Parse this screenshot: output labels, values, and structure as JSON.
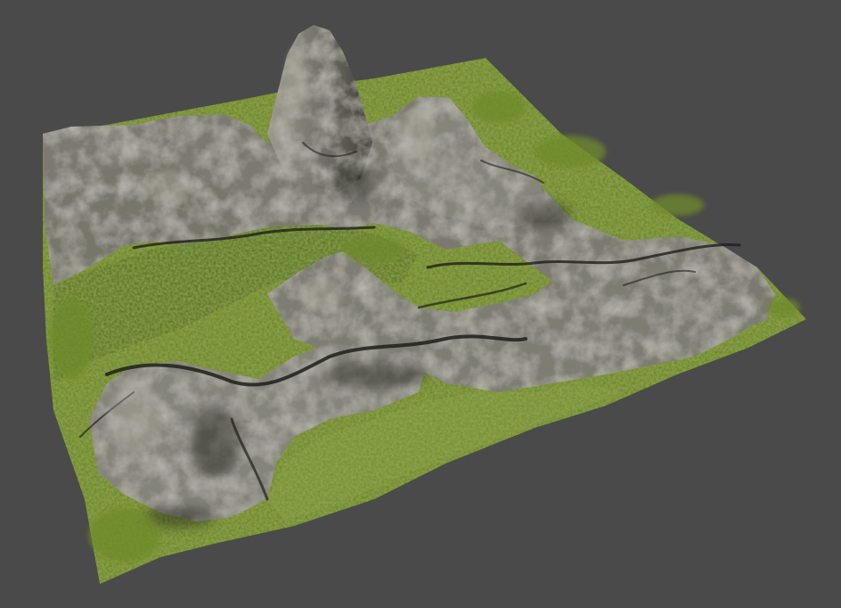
{
  "scene": {
    "background_color": "#4a4a4a",
    "subject": "terrain-mesh",
    "colors": {
      "grass": "#6f8a2c",
      "grass_dark": "#4d6620",
      "grass_light": "#8fa53b",
      "rock": "#7b7a70",
      "rock_light": "#a3a196",
      "rock_dark": "#3e3d36",
      "crevice": "#1f1e1a"
    }
  }
}
